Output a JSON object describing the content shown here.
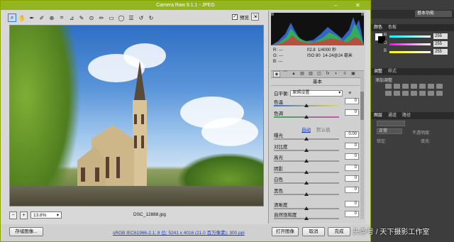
{
  "window": {
    "title": "Camera Raw 9.1.1 - JPEG"
  },
  "toolbar": {
    "tools": [
      "zoom-icon",
      "hand-icon",
      "white-balance-icon",
      "color-sampler-icon",
      "target-adjust-icon",
      "crop-icon",
      "straighten-icon",
      "spot-removal-icon",
      "red-eye-icon",
      "adjust-brush-icon",
      "graduated-filter-icon",
      "radial-filter-icon",
      "preferences-icon",
      "rotate-ccw-icon",
      "rotate-cw-icon"
    ],
    "preview_label": "预览",
    "preview_checked": "✓"
  },
  "status": {
    "zoom": "13.8%",
    "filename": "DSC_12888.jpg"
  },
  "histogram_meta": {
    "r": "R:",
    "g": "G:",
    "b": "B:",
    "r_val": "---",
    "g_val": "---",
    "b_val": "---",
    "aperture": "f/2.8",
    "shutter": "1/4000 秒",
    "iso": "ISO 80",
    "focal": "14-24@24 毫米"
  },
  "panel": {
    "title": "基本",
    "wb_label": "白平衡:",
    "wb_value": "原照设置",
    "auto_label": "自动",
    "default_label": "默认值",
    "sliders_top": [
      {
        "label": "色温",
        "value": "0"
      },
      {
        "label": "色调",
        "value": "0"
      }
    ],
    "sliders_bottom": [
      {
        "label": "曝光",
        "value": "0.00"
      },
      {
        "label": "对比度",
        "value": "0"
      },
      {
        "label": "高光",
        "value": "0"
      },
      {
        "label": "阴影",
        "value": "0"
      },
      {
        "label": "白色",
        "value": "0"
      },
      {
        "label": "黑色",
        "value": "0"
      },
      {
        "label": "清晰度",
        "value": "0"
      },
      {
        "label": "自然饱和度",
        "value": "0"
      }
    ]
  },
  "bottom": {
    "save_label": "存储图像...",
    "workflow": "sRGB IEC61966-2.1; 8 位; 5241 x 4016 (21.0 百万像素); 300 ppi",
    "open_label": "打开图像",
    "cancel_label": "取消",
    "done_label": "完成"
  },
  "ps": {
    "workspace": "基本功能",
    "color_tab": "颜色",
    "swatches_tab": "色板",
    "adjust_tab": "调整",
    "styles_tab": "样式",
    "add_adjust": "添加调整",
    "layers_tab": "图层",
    "channels_tab": "通道",
    "paths_tab": "路径",
    "blend": "正常",
    "opacity_label": "不透明度:",
    "lock_label": "锁定:",
    "fill_label": "填充:",
    "colors": [
      {
        "label": "R",
        "value": "255"
      },
      {
        "label": "G",
        "value": "255"
      },
      {
        "label": "B",
        "value": "255"
      }
    ]
  },
  "watermark": "头条号 / 天下摄影工作室"
}
